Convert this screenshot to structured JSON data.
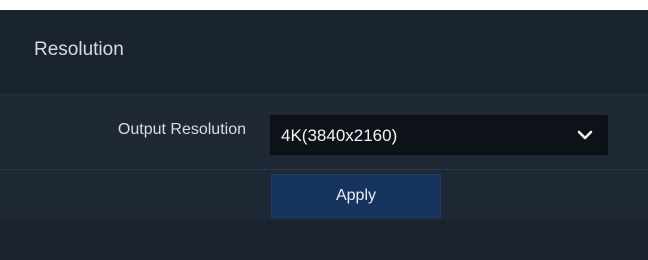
{
  "section": {
    "title": "Resolution"
  },
  "output_resolution": {
    "label": "Output Resolution",
    "value": "4K(3840x2160)"
  },
  "actions": {
    "apply_label": "Apply"
  },
  "icons": {
    "dropdown": "chevron-down-icon"
  },
  "colors": {
    "background": "#1b2430",
    "select_background": "#0d1118",
    "apply_button": "#16345e",
    "text": "#d9dde3"
  }
}
